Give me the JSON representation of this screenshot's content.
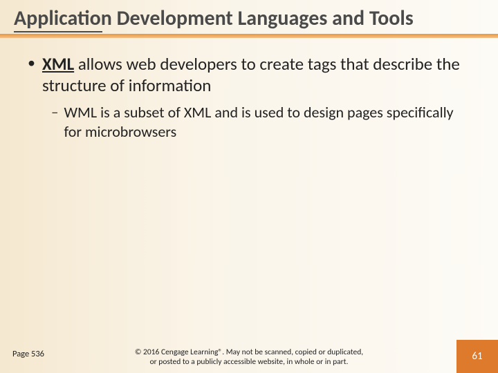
{
  "title": "Application Development Languages and Tools",
  "bullet1": {
    "term": "XML",
    "rest": " allows web developers to create tags that describe the structure of information"
  },
  "bullet2": "WML is a subset of XML and is used to design pages specifically for microbrowsers",
  "pageRef": "Page 536",
  "copyright": "© 2016 Cengage Learning®. May not be scanned, copied or duplicated, or posted to a publicly accessible website, in whole or in part.",
  "slideNumber": "61"
}
